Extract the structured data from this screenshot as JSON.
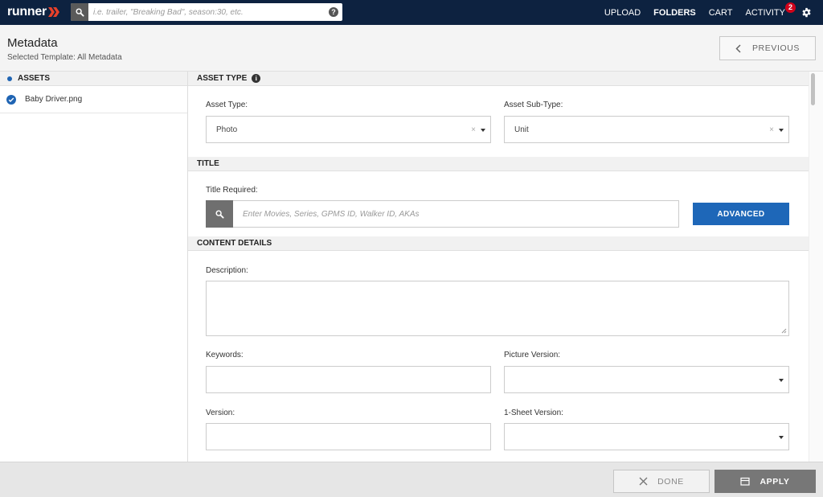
{
  "app": {
    "logo": "runner"
  },
  "search": {
    "placeholder": "i.e. trailer, \"Breaking Bad\", season:30, etc.",
    "help": "?"
  },
  "nav": {
    "upload": "UPLOAD",
    "folders": "FOLDERS",
    "cart": "CART",
    "activity": "ACTIVITY",
    "activity_badge": "2"
  },
  "header": {
    "title": "Metadata",
    "subtitle": "Selected Template: All Metadata",
    "previous": "PREVIOUS"
  },
  "sidebar": {
    "title": "ASSETS",
    "items": [
      {
        "label": "Baby Driver.png"
      }
    ]
  },
  "sections": {
    "asset_type": {
      "title": "ASSET TYPE",
      "type_label": "Asset Type:",
      "type_value": "Photo",
      "subtype_label": "Asset Sub-Type:",
      "subtype_value": "Unit"
    },
    "title": {
      "title": "TITLE",
      "required_label": "Title Required:",
      "placeholder": "Enter Movies, Series, GPMS ID, Walker ID, AKAs",
      "advanced": "ADVANCED"
    },
    "content_details": {
      "title": "CONTENT DETAILS",
      "description_label": "Description:",
      "keywords_label": "Keywords:",
      "picture_version_label": "Picture Version:",
      "version_label": "Version:",
      "sheet_version_label": "1-Sheet Version:"
    }
  },
  "footer": {
    "done": "DONE",
    "apply": "APPLY"
  },
  "colors": {
    "topbar": "#0d2240",
    "accent": "#1e67b8",
    "badge": "#d0021b",
    "logo_chevron": "#e8412a"
  }
}
